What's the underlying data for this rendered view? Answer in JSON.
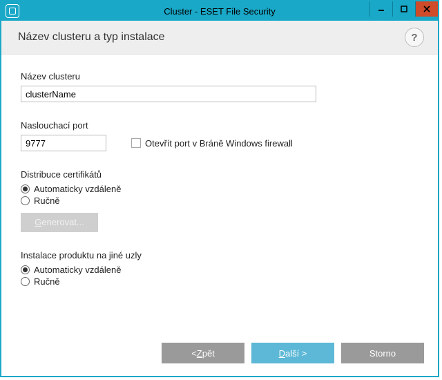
{
  "window": {
    "title": "Cluster - ESET File Security"
  },
  "header": {
    "title": "Název clusteru a typ instalace",
    "help": "?"
  },
  "clusterName": {
    "label": "Název clusteru",
    "value": "clusterName"
  },
  "port": {
    "label": "Naslouchací port",
    "value": "9777"
  },
  "firewall": {
    "label": "Otevřít port v Bráně Windows firewall",
    "checked": false
  },
  "certDist": {
    "label": "Distribuce certifikátů",
    "opt1": "Automaticky vzdáleně",
    "opt2": "Ručně",
    "generate_prefix": "G",
    "generate_rest": "enerovat..."
  },
  "install": {
    "label": "Instalace produktu na jiné uzly",
    "opt1": "Automaticky vzdáleně",
    "opt2": "Ručně"
  },
  "footer": {
    "back_prefix": "< ",
    "back_ul": "Z",
    "back_rest": "pět",
    "next_ul": "D",
    "next_rest": "alší >",
    "cancel": "Storno"
  }
}
